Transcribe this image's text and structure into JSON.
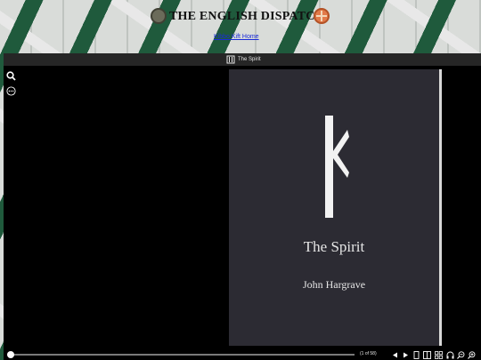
{
  "site": {
    "title": "THE ENGLISH DISPATCH",
    "link_text": "Kibbo Kift Home"
  },
  "viewer": {
    "document_title": "The Spirit",
    "page_count": "(1 of 58)",
    "progress": 0.01,
    "colors": {
      "background": "#000000",
      "toolbar": "#262626",
      "page": "#2c2b33",
      "text": "#e6e6e6"
    }
  },
  "book": {
    "title": "The Spirit",
    "author": "John Hargrave",
    "rune_icon": "kibbo-kift-rune-icon"
  },
  "icons": {
    "left_tools": [
      "search-icon",
      "more-options-icon"
    ],
    "controls": [
      "previous-page-icon",
      "next-page-icon",
      "single-page-icon",
      "two-page-icon",
      "grid-view-icon",
      "audio-icon",
      "zoom-out-icon",
      "zoom-in-icon"
    ]
  }
}
